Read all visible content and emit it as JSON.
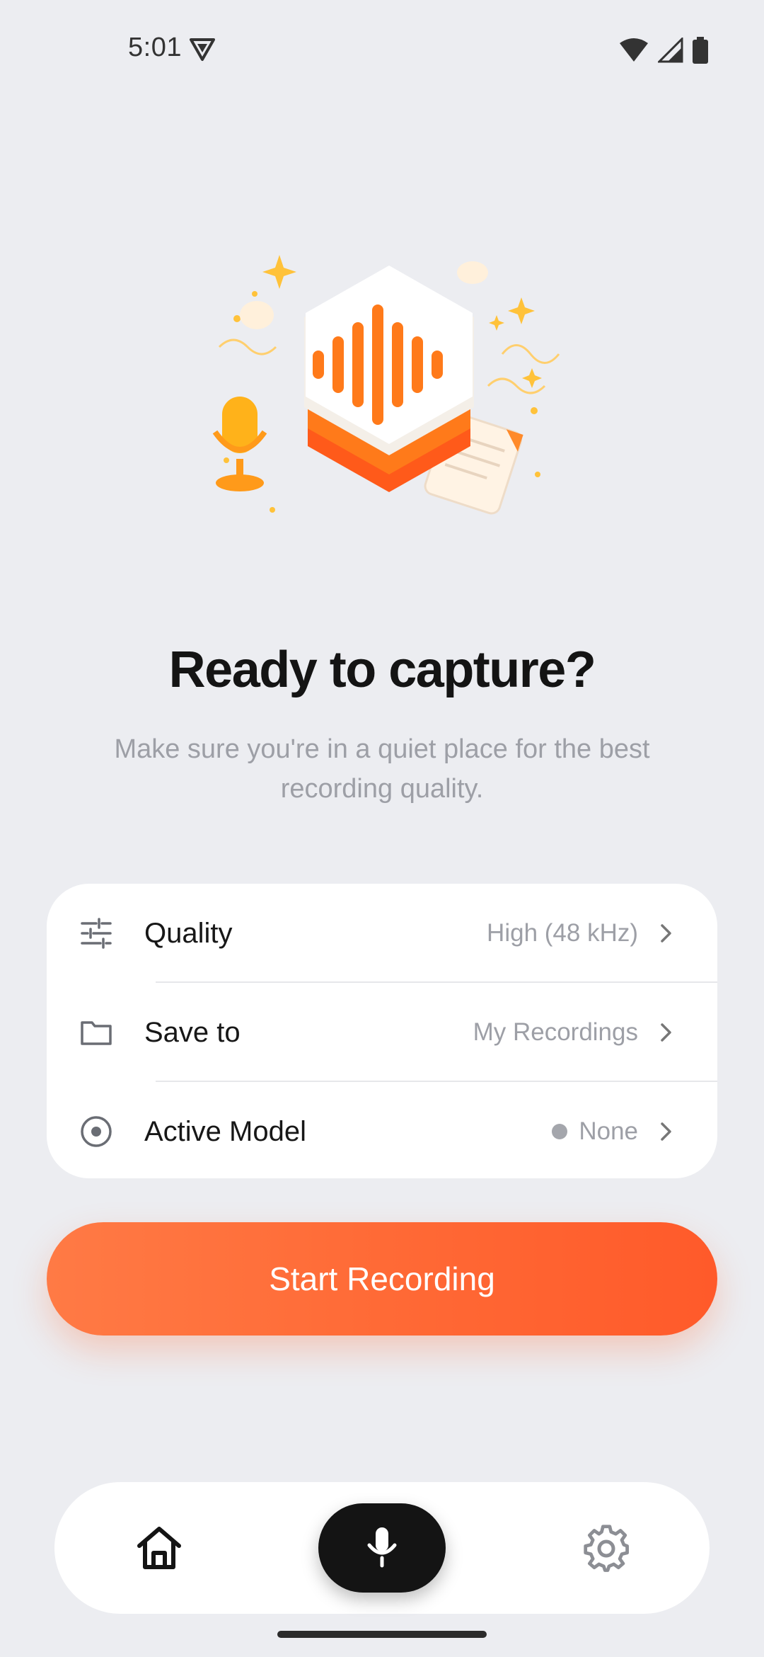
{
  "status_bar": {
    "time": "5:01",
    "left_icon": "vpn-shield-icon",
    "right_icons": [
      "wifi-icon",
      "cellular-signal-icon",
      "battery-icon"
    ]
  },
  "hero": {
    "illustration": "audio-waveform-hexagon-illustration",
    "accent": "#FF7A1A"
  },
  "main": {
    "title": "Ready to capture?",
    "subtitle": "Make sure you're in a quiet place for the best recording quality."
  },
  "settings": [
    {
      "icon": "sliders-icon",
      "label": "Quality",
      "value": "High (48 kHz)"
    },
    {
      "icon": "folder-icon",
      "label": "Save to",
      "value": "My Recordings"
    },
    {
      "icon": "radio-target-icon",
      "label": "Active Model",
      "value": "None",
      "status_dot": "#A4A6AC"
    }
  ],
  "start_button": {
    "label": "Start Recording",
    "color": "#FF6A36"
  },
  "bottom_nav": {
    "items": [
      "home-icon",
      "microphone-icon",
      "gear-icon"
    ],
    "active": "microphone-icon"
  }
}
